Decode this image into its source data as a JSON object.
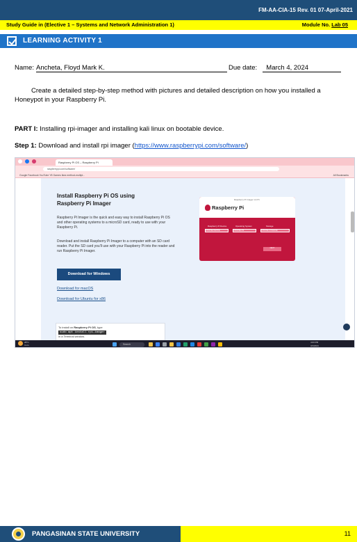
{
  "header": {
    "form_code": "FM-AA-CIA-15 Rev. 01  07-April-2021",
    "study_guide": "Study Guide in (Elective 1 – Systems and Network Administration 1)",
    "module_label": "Module No. ",
    "module_value": "Lab 05"
  },
  "activity": {
    "title": "LEARNING ACTIVITY 1"
  },
  "form": {
    "name_label": "Name: ",
    "name_value": "Ancheta, Floyd Mark K.",
    "due_label": "Due date: ",
    "due_value": "March 4, 2024"
  },
  "instructions": "Create a detailed step-by-step method with pictures and detailed description on how you installed a Honeypot in your Raspberry Pi.",
  "part1": {
    "label": "PART I:",
    "text": " Installing rpi-imager and installing kali linux on bootable device."
  },
  "step1": {
    "label": "Step 1:",
    "text": " Download and install rpi imager (",
    "link": "https://www.raspberrypi.com/software/",
    "close": ")"
  },
  "screenshot": {
    "tab_title": "Raspberry Pi OS – Raspberry Pi",
    "url": "raspberrypi.com/software/",
    "bookmarks": "Google   Facebook   YouTube   Y8 Games   Ikea method-multipl...",
    "all_bookmarks": "All Bookmarks",
    "heading": "Install Raspberry Pi OS using Raspberry Pi Imager",
    "para1": "Raspberry Pi Imager is the quick and easy way to install Raspberry Pi OS and other operating systems to a microSD card, ready to use with your Raspberry Pi.",
    "para2": "Download and install Raspberry Pi Imager to a computer with an SD card reader. Put the SD card you'll use with your Raspberry Pi into the reader and run Raspberry Pi Imager.",
    "download_windows": "Download for Windows",
    "download_macos": "Download for macOS",
    "download_ubuntu": "Download for Ubuntu for x86",
    "install_note_prefix": "To install on ",
    "install_note_os": "Raspberry Pi OS",
    "install_note_suffix": ", type",
    "install_cmd": "sudo apt install rpi-imager",
    "install_note_end": "in a Terminal window.",
    "imager_window_title": "Raspberry Pi Imager v1.8.5",
    "imager_brand": "Raspberry Pi",
    "imager_col1": "Raspberry Pi Device",
    "imager_col2": "Operating System",
    "imager_col3": "Storage",
    "imager_btn1": "CHOOSE DEVICE",
    "imager_btn2": "CHOOSE OS",
    "imager_btn3": "CHOOSE STORAGE",
    "imager_next": "NEXT",
    "taskbar_weather_temp": "28°C",
    "taskbar_weather_text": "Haze",
    "taskbar_search": "Search",
    "taskbar_time": "4:03 PM",
    "taskbar_date": "3/1/2024"
  },
  "footer": {
    "university": "PANGASINAN STATE UNIVERSITY",
    "page": "11"
  }
}
